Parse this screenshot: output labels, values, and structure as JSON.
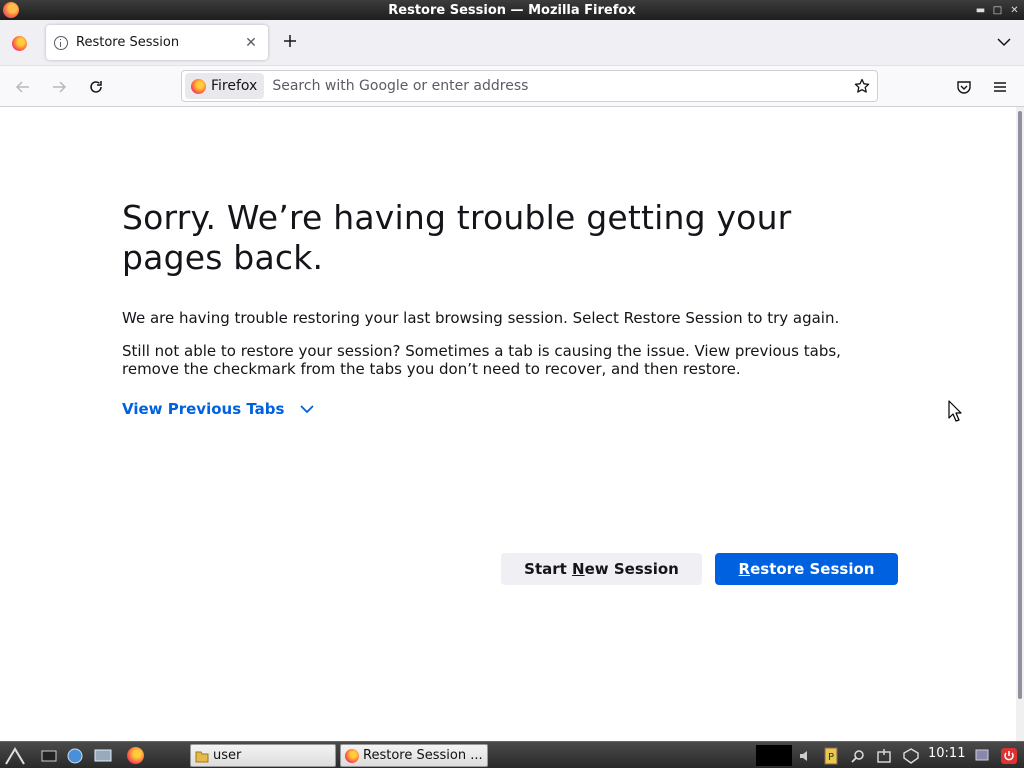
{
  "window": {
    "title": "Restore Session — Mozilla Firefox"
  },
  "tabs": [
    {
      "title": "Restore Session",
      "active": true
    }
  ],
  "urlbar": {
    "identity_label": "Firefox",
    "placeholder": "Search with Google or enter address"
  },
  "page": {
    "heading": "Sorry. We’re having trouble getting your pages back.",
    "paragraph1": "We are having trouble restoring your last browsing session. Select Restore Session to try again.",
    "paragraph2": "Still not able to restore your session? Sometimes a tab is causing the issue. View previous tabs, remove the checkmark from the tabs you don’t need to recover, and then restore.",
    "view_previous_tabs": "View Previous Tabs",
    "start_new_button": {
      "before": "Start ",
      "accesskey": "N",
      "after": "ew Session"
    },
    "restore_button": {
      "before": "",
      "accesskey": "R",
      "after": "estore Session"
    }
  },
  "taskbar": {
    "tasks": [
      {
        "label": "user"
      },
      {
        "label": "Restore Session ..."
      }
    ],
    "clock": "10:11"
  },
  "colors": {
    "accent": "#0061e0",
    "secondary_button": "#f0f0f4",
    "text": "#15141a"
  }
}
